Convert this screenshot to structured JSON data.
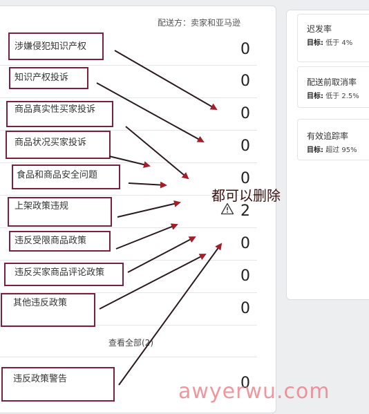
{
  "main": {
    "shipping_label": "配送方：卖家和亚马逊",
    "rows": [
      {
        "label": "涉嫌侵犯知识产权",
        "value": "0"
      },
      {
        "label": "知识产权投诉",
        "value": "0"
      },
      {
        "label": "商品真实性买家投诉",
        "value": "0"
      },
      {
        "label": "商品状况买家投诉",
        "value": "0"
      },
      {
        "label": "食品和商品安全问题",
        "value": "0"
      },
      {
        "label": "上架政策违规",
        "value": "2"
      },
      {
        "label": "违反受限商品政策",
        "value": "0"
      },
      {
        "label": "违反买家商品评论政策",
        "value": "0"
      },
      {
        "label": "其他违反政策",
        "value": "0"
      }
    ],
    "view_all": "查看全部(2)",
    "warning_row": {
      "label": "违反政策警告",
      "value": "0"
    }
  },
  "right_panel": {
    "metrics": [
      {
        "title": "迟发率",
        "target_label": "目标:",
        "target_value": "低于 4%"
      },
      {
        "title": "配送前取消率",
        "target_label": "目标:",
        "target_value": "低于 2.5%"
      },
      {
        "title": "有效追踪率",
        "target_label": "目标:",
        "target_value": "超过 95%"
      }
    ]
  },
  "annotation": {
    "text": "都可以删除",
    "box_color": "#7b1f3a",
    "arrow_color": "#a31d2a"
  },
  "watermark": "awyerwu.com",
  "icons": {
    "warning": "warning-triangle-icon"
  }
}
